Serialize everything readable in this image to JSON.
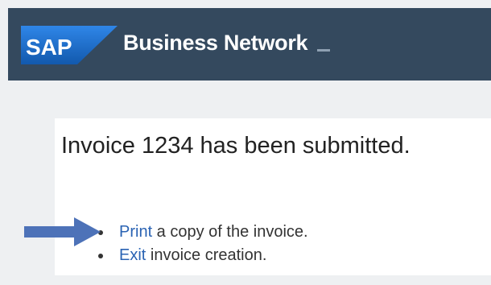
{
  "header": {
    "logo_text": "SAP",
    "title": "Business Network"
  },
  "confirmation": {
    "message": "Invoice 1234 has been submitted."
  },
  "actions": [
    {
      "link": "Print",
      "rest": " a copy of the invoice."
    },
    {
      "link": "Exit",
      "rest": " invoice creation."
    }
  ],
  "colors": {
    "header_background": "#34495e",
    "logo_blue": "#1f78d1",
    "link": "#2a63b3",
    "pointer_arrow": "#4d72b8"
  },
  "icons": {
    "pointer": "right-arrow-icon",
    "menu_toggle": "chevron-down-icon"
  }
}
